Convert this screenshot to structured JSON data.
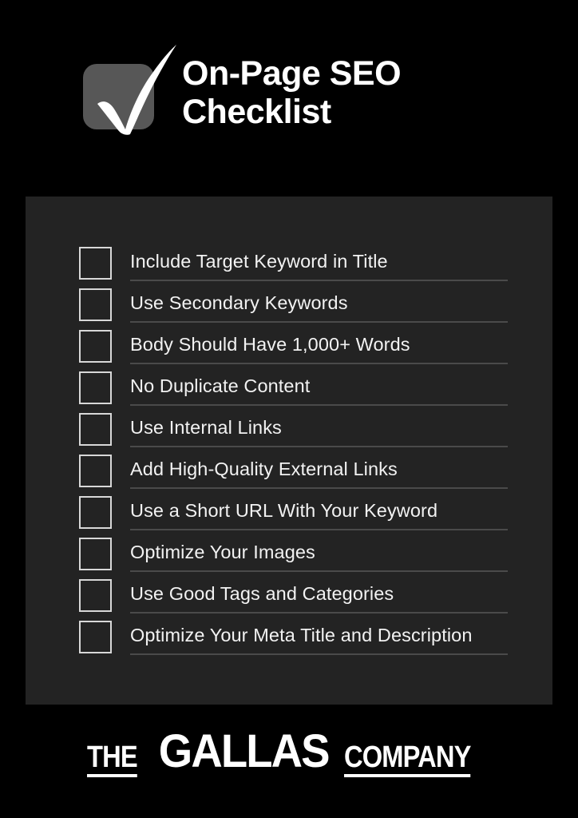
{
  "page": {
    "background_color": "#000000",
    "card_color": "#232323",
    "accent_color": "#575757",
    "text_color": "#ffffff",
    "rule_color": "#4a4a4a"
  },
  "header": {
    "badge_icon": "checkmark-icon",
    "title": "On-Page SEO\nChecklist"
  },
  "checklist": {
    "items": [
      {
        "label": "Include Target Keyword in Title",
        "checked": false
      },
      {
        "label": "Use Secondary Keywords",
        "checked": false
      },
      {
        "label": "Body Should Have 1,000+ Words",
        "checked": false
      },
      {
        "label": "No Duplicate Content",
        "checked": false
      },
      {
        "label": "Use Internal Links",
        "checked": false
      },
      {
        "label": "Add High-Quality External Links",
        "checked": false
      },
      {
        "label": "Use a Short URL With Your Keyword",
        "checked": false
      },
      {
        "label": "Optimize Your Images",
        "checked": false
      },
      {
        "label": "Use Good Tags and Categories",
        "checked": false
      },
      {
        "label": "Optimize Your Meta Title and Description",
        "checked": false
      }
    ]
  },
  "footer": {
    "logo_the": "THE",
    "logo_name": "GALLAS",
    "logo_company": "COMPANY"
  }
}
